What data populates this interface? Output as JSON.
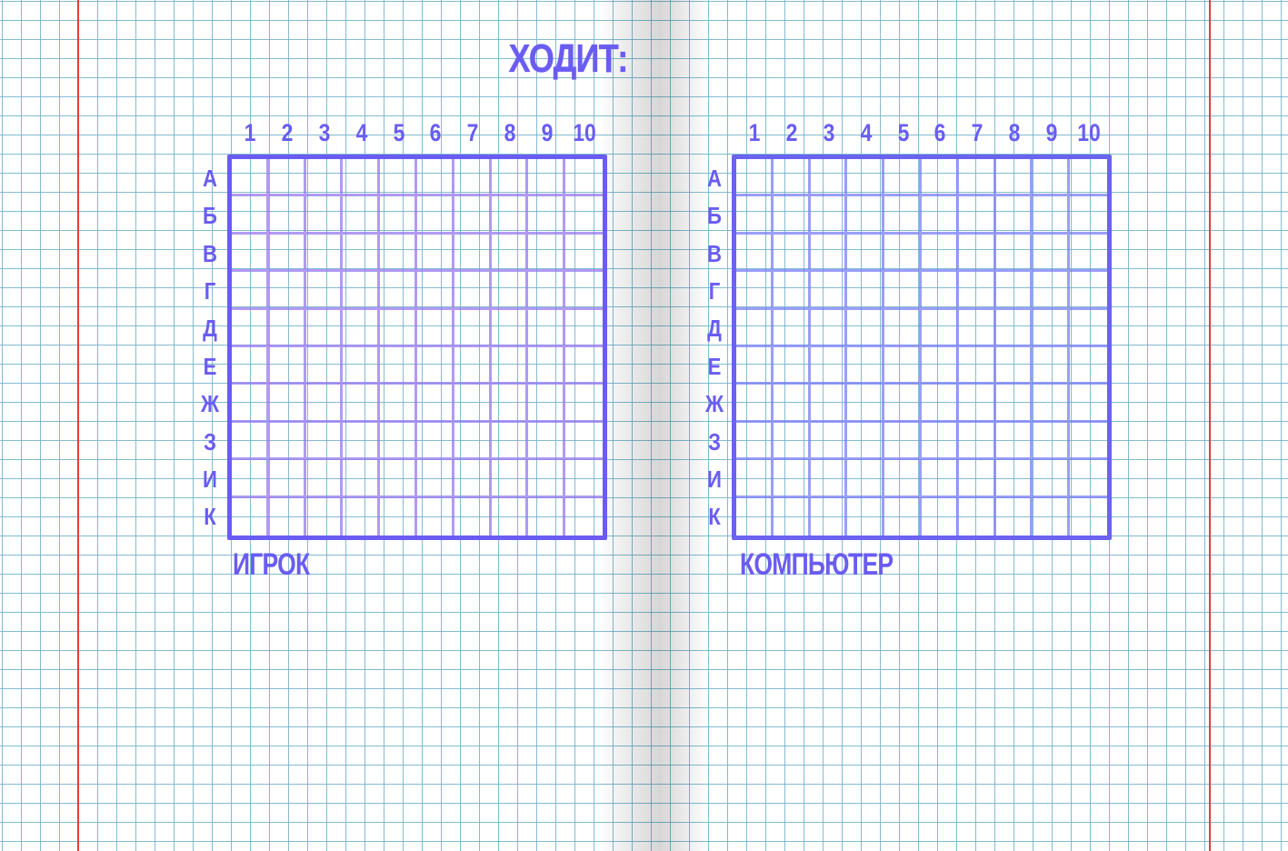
{
  "status": {
    "turn_label": "ХОДИТ:"
  },
  "boards": {
    "player": {
      "label": "ИГРОК"
    },
    "computer": {
      "label": "КОМПЬЮТЕР"
    }
  },
  "columns": [
    "1",
    "2",
    "3",
    "4",
    "5",
    "6",
    "7",
    "8",
    "9",
    "10"
  ],
  "rows": [
    "А",
    "Б",
    "В",
    "Г",
    "Д",
    "Е",
    "Ж",
    "З",
    "И",
    "К"
  ],
  "colors": {
    "ink": "#6a5cf2",
    "paper_grid": "#6eafc8",
    "margin_line": "#e0403a",
    "paper": "#ffffff"
  },
  "icons": {
    "background": "graph-paper-notebook"
  }
}
